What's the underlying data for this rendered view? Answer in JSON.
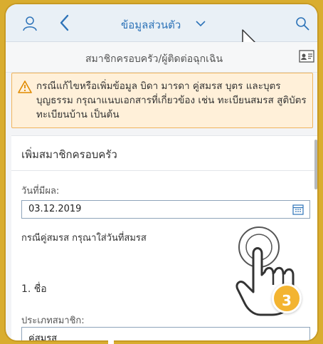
{
  "header": {
    "title": "ข้อมูลส่วนตัว",
    "left_icon": "user-icon",
    "back_icon": "back-icon",
    "menu_icon": "chevron-down-icon",
    "search_icon": "search-icon"
  },
  "subheader": {
    "title": "สมาชิกครอบครัว/ผู้ติดต่อฉุกเฉิน",
    "right_icon": "id-card-icon"
  },
  "warning": {
    "text": "กรณีแก้ไขหรือเพิ่มข้อมูล บิดา มารดา คู่สมรส บุตร และบุตรบุญธรรม กรุณาแนบเอกสารที่เกี่ยวข้อง เช่น ทะเบียนสมรส สูติบัตร ทะเบียนบ้าน เป็นต้น"
  },
  "form": {
    "section_title": "เพิ่มสมาชิกครอบครัว",
    "effective_date_label": "วันที่มีผล:",
    "effective_date_value": "03.12.2019",
    "spouse_note": "กรณีคู่สมรส กรุณาใส่วันที่สมรส",
    "name_label": "1. ชื่อ",
    "member_type_label": "ประเภทสมาชิก:",
    "member_type_value": "คู่สมรส"
  },
  "overlay": {
    "step_number": "3"
  },
  "colors": {
    "accent": "#2d73b8",
    "warning_bg": "#fff0d9",
    "warning_border": "#f0b45c",
    "background": "#d9ad2f",
    "badge": "#f3b431"
  }
}
